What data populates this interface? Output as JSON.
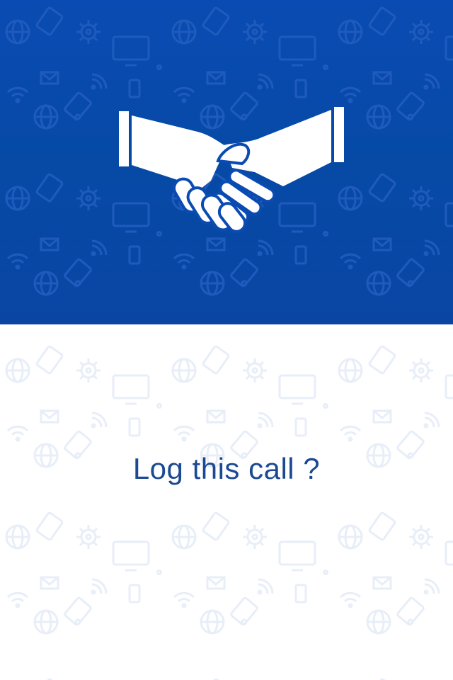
{
  "dialog": {
    "question": "Log this call ?"
  },
  "colors": {
    "hero_background": "#0a4bb3",
    "pattern_on_hero": "#1f5bbd",
    "pattern_on_white": "#e8eef8",
    "question_text": "#1b4a93"
  },
  "icons": {
    "hero_symbol": "handshake-icon",
    "background_pattern": [
      "globe-icon",
      "gear-icon",
      "monitor-icon",
      "wifi-icon",
      "envelope-icon",
      "phone-icon",
      "tablet-icon"
    ]
  }
}
